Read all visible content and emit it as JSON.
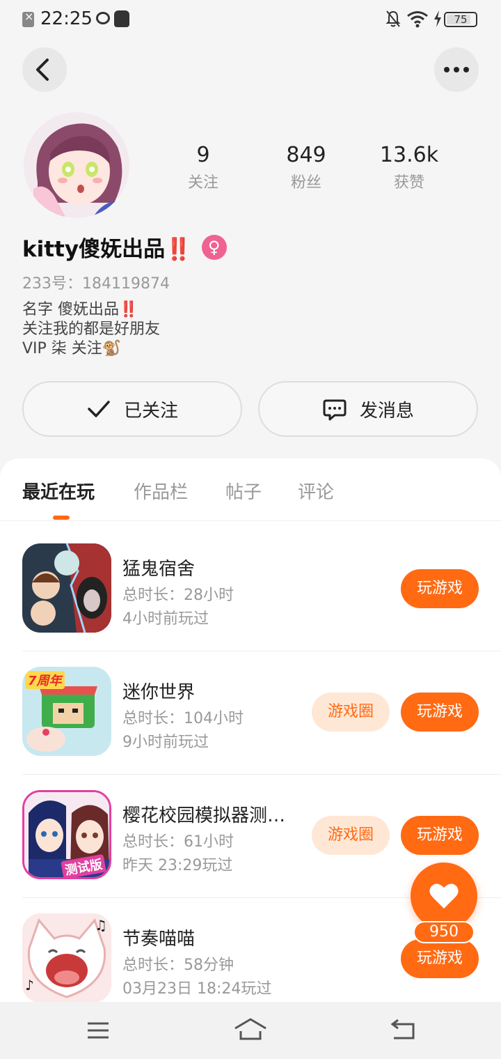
{
  "status_bar": {
    "time": "22:25",
    "battery": "75"
  },
  "profile": {
    "stats": [
      {
        "value": "9",
        "label": "关注"
      },
      {
        "value": "849",
        "label": "粉丝"
      },
      {
        "value": "13.6k",
        "label": "获赞"
      }
    ],
    "name": "kitty傻妩出品‼️",
    "gender_symbol": "♀",
    "id_text": "233号：184119874",
    "bio_lines": [
      "名字 傻妩出品‼️",
      "关注我的都是好朋友",
      "VIP 柒 关注🐒"
    ]
  },
  "actions": {
    "follow_label": "已关注",
    "message_label": "发消息"
  },
  "tabs": [
    "最近在玩",
    "作品栏",
    "帖子",
    "评论"
  ],
  "games": [
    {
      "title": "猛鬼宿舍",
      "duration": "总时长：28小时",
      "last_played": "4小时前玩过",
      "play_label": "玩游戏"
    },
    {
      "title": "迷你世界",
      "duration": "总时长：104小时",
      "last_played": "9小时前玩过",
      "circle_label": "游戏圈",
      "play_label": "玩游戏"
    },
    {
      "title": "樱花校园模拟器测…",
      "duration": "总时长：61小时",
      "last_played": "昨天 23:29玩过",
      "circle_label": "游戏圈",
      "play_label": "玩游戏"
    },
    {
      "title": "节奏喵喵",
      "duration": "总时长：58分钟",
      "last_played": "03月23日 18:24玩过",
      "play_label": "玩游戏"
    }
  ],
  "mini_world_badge": "7周年",
  "sakura_badge": "测试版",
  "floating": {
    "like_count": "950"
  },
  "colors": {
    "accent": "#ff6a13",
    "accent_light": "#ffe7d6",
    "gender": "#f06292"
  },
  "icons": [
    "back-arrow-icon",
    "more-dots-icon",
    "check-icon",
    "chat-bubble-icon",
    "heart-icon",
    "menu-icon",
    "home-icon",
    "return-icon"
  ]
}
